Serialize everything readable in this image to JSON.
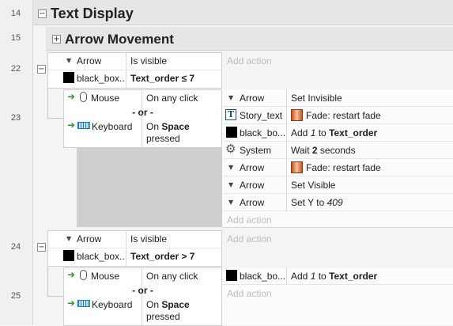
{
  "rows": {
    "r14": "14",
    "r15": "15",
    "r22": "22",
    "r23": "23",
    "r24": "24",
    "r25": "25"
  },
  "groups": {
    "text_display": "Text Display",
    "arrow_movement": "Arrow Movement"
  },
  "event22": {
    "cond1_obj": "Arrow",
    "cond1_text": "Is visible",
    "cond2_obj": "black_box...",
    "cond2_text": "Text_order ≤ 7",
    "add_action": "Add action"
  },
  "event23": {
    "mouse_obj": "Mouse",
    "mouse_text": "On any click",
    "or": "- or -",
    "kb_obj": "Keyboard",
    "kb_text_1": "On ",
    "kb_text_bold": "Space",
    "kb_text_2": "pressed",
    "actions": [
      {
        "obj": "Arrow",
        "text": "Set Invisible"
      },
      {
        "obj": "Story_text",
        "text": "Fade: restart fade"
      },
      {
        "obj": "black_bo...",
        "pre": "Add ",
        "italic": "1",
        "mid": " to ",
        "bold": "Text_order"
      },
      {
        "obj": "System",
        "pre": "Wait ",
        "bold": "2",
        "post": " seconds"
      },
      {
        "obj": "Arrow",
        "text": "Fade: restart fade"
      },
      {
        "obj": "Arrow",
        "text": "Set Visible"
      },
      {
        "obj": "Arrow",
        "pre": "Set Y to ",
        "italic": "409"
      }
    ],
    "add_action": "Add action"
  },
  "event24": {
    "cond1_obj": "Arrow",
    "cond1_text": "Is visible",
    "cond2_obj": "black_box...",
    "cond2_text": "Text_order > 7",
    "add_action": "Add action"
  },
  "event25": {
    "mouse_obj": "Mouse",
    "mouse_text": "On any click",
    "or": "- or -",
    "kb_obj": "Keyboard",
    "kb_text_1": "On ",
    "kb_text_bold": "Space",
    "kb_text_2": "pressed",
    "action_obj": "black_bo...",
    "action_pre": "Add ",
    "action_italic": "1",
    "action_mid": " to ",
    "action_bold": "Text_order",
    "add_action": "Add action"
  }
}
